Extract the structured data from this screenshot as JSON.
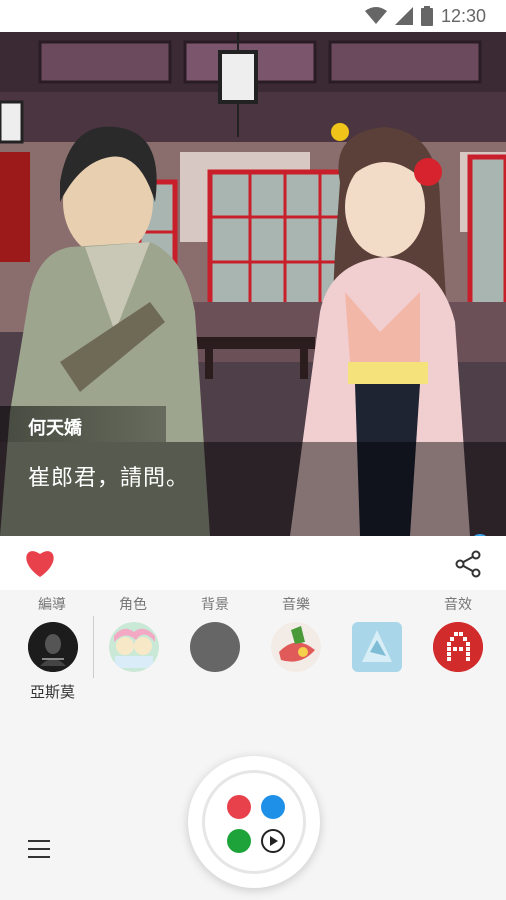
{
  "status_bar": {
    "time": "12:30",
    "icons": [
      "wifi-icon",
      "signal-icon",
      "battery-icon"
    ]
  },
  "scene": {
    "speaker_name": "何天嬌",
    "dialog_text": "崔郎君，請問。"
  },
  "actions": {
    "like_icon": "heart-icon",
    "share_icon": "share-icon",
    "like_color": "#e8414b"
  },
  "categories": {
    "director": "編導",
    "characters": "角色",
    "background": "背景",
    "music": "音樂",
    "sound_effect": "音效"
  },
  "director_name": "亞斯莫",
  "fab": {
    "dot_colors": [
      "#e8414b",
      "#1e90e8",
      "#1ea33a"
    ],
    "play_icon": "play-icon"
  },
  "menu_icon": "hamburger-menu-icon"
}
